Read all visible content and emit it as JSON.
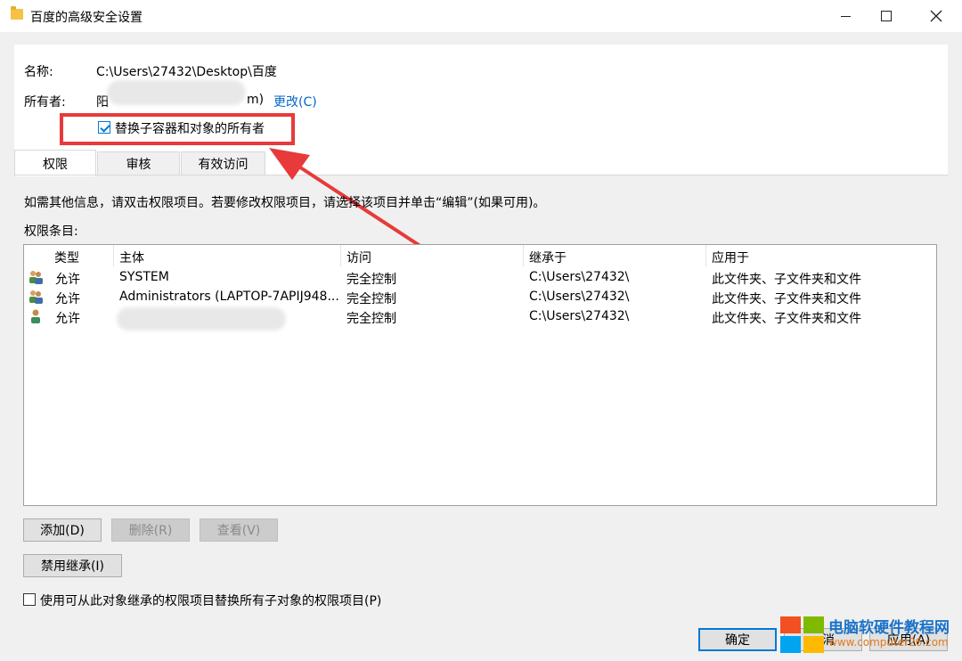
{
  "window": {
    "title": "百度的高级安全设置",
    "icon": "folder-icon"
  },
  "owner_section": {
    "name_label": "名称:",
    "name_value": "C:\\Users\\27432\\Desktop\\百度",
    "owner_label": "所有者:",
    "owner_value_start": "阳",
    "owner_value_end": "m)",
    "change_link": "更改(C)",
    "replace_owner_checkbox": {
      "label": "替换子容器和对象的所有者",
      "checked": true
    }
  },
  "tabs": [
    {
      "label": "权限",
      "active": true
    },
    {
      "label": "审核",
      "active": false
    },
    {
      "label": "有效访问",
      "active": false
    }
  ],
  "info_text": "如需其他信息，请双击权限项目。若要修改权限项目，请选择该项目并单击“编辑”(如果可用)。",
  "entries_label": "权限条目:",
  "table": {
    "columns": [
      "类型",
      "主体",
      "访问",
      "继承于",
      "应用于"
    ],
    "rows": [
      {
        "icon": "user-group-icon",
        "type": "允许",
        "principal": "SYSTEM",
        "access": "完全控制",
        "inherited": "C:\\Users\\27432\\",
        "applies": "此文件夹、子文件夹和文件"
      },
      {
        "icon": "user-group-icon",
        "type": "允许",
        "principal": "Administrators (LAPTOP-7APIJ948...",
        "access": "完全控制",
        "inherited": "C:\\Users\\27432\\",
        "applies": "此文件夹、子文件夹和文件"
      },
      {
        "icon": "user-icon",
        "type": "允许",
        "principal": "",
        "access": "完全控制",
        "inherited": "C:\\Users\\27432\\",
        "applies": "此文件夹、子文件夹和文件"
      }
    ]
  },
  "buttons": {
    "add": "添加(D)",
    "remove": "删除(R)",
    "view": "查看(V)",
    "disable_inheritance": "禁用继承(I)",
    "ok": "确定",
    "cancel": "消",
    "apply": "应用(A)"
  },
  "replace_child_checkbox": {
    "label": "使用可从此对象继承的权限项目替换所有子对象的权限项目(P)",
    "checked": false
  },
  "watermark": {
    "text": "电脑软硬件教程网",
    "url": "www.computer26.com"
  },
  "colors": {
    "accent": "#0078d7",
    "annotation_red": "#e83a3a",
    "link": "#0066cc"
  }
}
